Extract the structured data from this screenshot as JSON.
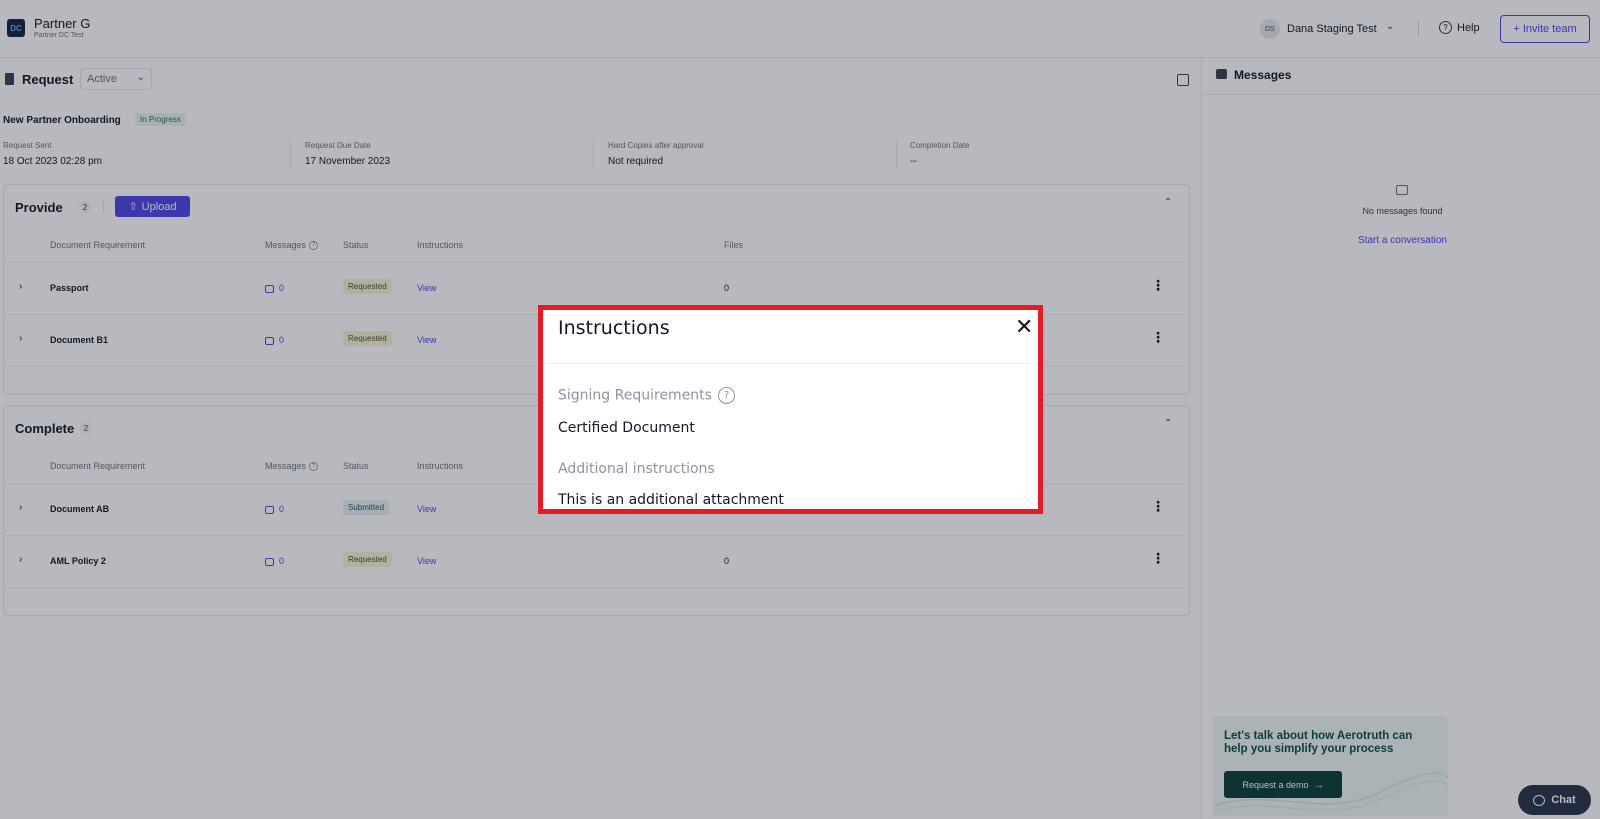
{
  "header": {
    "logo_text": "DC",
    "org_name": "Partner G",
    "org_sub": "Partner DC Test",
    "user_initials": "DS",
    "user_name": "Dana Staging Test",
    "help_label": "Help",
    "invite_label": "+ Invite team"
  },
  "request": {
    "title": "Request",
    "status_select": "Active",
    "name": "New Partner Onboarding",
    "progress_badge": "In Progress",
    "meta": [
      {
        "label": "Request Sent",
        "value": "18 Oct 2023 02:28 pm"
      },
      {
        "label": "Request Due Date",
        "value": "17 November 2023"
      },
      {
        "label": "Hard Copies after approval",
        "value": "Not required"
      },
      {
        "label": "Completion Date",
        "value": "--"
      }
    ]
  },
  "columns": {
    "doc": "Document Requirement",
    "messages": "Messages",
    "status": "Status",
    "instructions": "Instructions",
    "files": "Files"
  },
  "provide": {
    "title": "Provide",
    "count": "2",
    "upload_label": "Upload",
    "rows": [
      {
        "name": "Passport",
        "messages": "0",
        "status": "Requested",
        "view": "View",
        "files": "0"
      },
      {
        "name": "Document B1",
        "messages": "0",
        "status": "Requested",
        "view": "View",
        "files": ""
      }
    ]
  },
  "complete": {
    "title": "Complete",
    "count": "2",
    "rows": [
      {
        "name": "Document AB",
        "messages": "0",
        "status": "Submitted",
        "view": "View",
        "files": ""
      },
      {
        "name": "AML Policy 2",
        "messages": "0",
        "status": "Requested",
        "view": "View",
        "files": "0"
      }
    ]
  },
  "messages_panel": {
    "title": "Messages",
    "empty_text": "No messages found",
    "start_link": "Start a conversation",
    "promo_text": "Let's talk about how Aerotruth can help you simplify your process",
    "promo_button": "Request a demo",
    "chat_label": "Chat"
  },
  "modal": {
    "title": "Instructions",
    "signing_label": "Signing Requirements",
    "signing_value": "Certified Document",
    "additional_label": "Additional instructions",
    "additional_value": "This is an additional attachment"
  },
  "colors": {
    "accent": "#4f46e5",
    "highlight_border": "#e21b25",
    "promo_dark": "#0e3f3c"
  }
}
